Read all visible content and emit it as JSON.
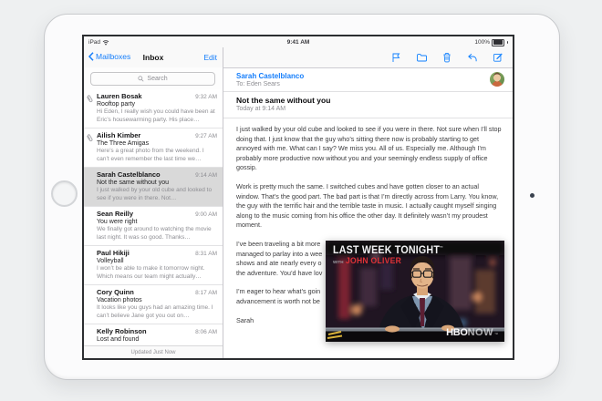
{
  "status_bar": {
    "carrier": "iPad",
    "time": "9:41 AM",
    "battery": "100%"
  },
  "mail_list": {
    "back_label": "Mailboxes",
    "title": "Inbox",
    "edit_label": "Edit",
    "search_placeholder": "Search",
    "footer": "Updated Just Now",
    "emails": [
      {
        "sender": "Lauren Bosak",
        "time": "9:32 AM",
        "subject": "Rooftop party",
        "preview": "Hi Eden, I really wish you could have been at Eric’s housewarming party. His place…",
        "has_attachment": true,
        "selected": false
      },
      {
        "sender": "Ailish Kimber",
        "time": "9:27 AM",
        "subject": "The Three Amigas",
        "preview": "Here’s a great photo from the weekend. I can’t even remember the last time we…",
        "has_attachment": true,
        "selected": false
      },
      {
        "sender": "Sarah Castelblanco",
        "time": "9:14 AM",
        "subject": "Not the same without you",
        "preview": "I just walked by your old cube and looked to see if you were in there. Not…",
        "has_attachment": false,
        "selected": true
      },
      {
        "sender": "Sean Reilly",
        "time": "9:00 AM",
        "subject": "You were right",
        "preview": "We finally got around to watching the movie last night. It was so good. Thanks…",
        "has_attachment": false,
        "selected": false
      },
      {
        "sender": "Paul Hikiji",
        "time": "8:31 AM",
        "subject": "Volleyball",
        "preview": "I won’t be able to make it tomorrow night. Which means our team might actually…",
        "has_attachment": false,
        "selected": false
      },
      {
        "sender": "Cory Quinn",
        "time": "8:17 AM",
        "subject": "Vacation photos",
        "preview": "It looks like you guys had an amazing time. I can’t believe Jane got you out on…",
        "has_attachment": false,
        "selected": false
      },
      {
        "sender": "Kelly Robinson",
        "time": "8:06 AM",
        "subject": "Lost and found",
        "preview": "",
        "has_attachment": false,
        "selected": false
      }
    ]
  },
  "toolbar": {
    "icons": [
      "flag-icon",
      "folder-icon",
      "trash-icon",
      "reply-icon",
      "compose-icon"
    ]
  },
  "message": {
    "sender": "Sarah Castelblanco",
    "recipient": "To: Eden Sears",
    "subject": "Not the same without you",
    "date": "Today at 9:14 AM",
    "paragraph1": "I just walked by your old cube and looked to see if you were in there. Not sure when I’ll stop doing that. I just know that the guy who’s sitting there now is probably starting to get annoyed with me. What can I say? We miss you. All of us. Especially me. Although I’m probably more productive now without you and your seemingly endless supply of office gossip.",
    "paragraph2": "Work is pretty much the same. I switched cubes and have gotten closer to an actual window. That’s the good part. The bad part is that I’m directly across from Larry. You know, the guy with the terrific hair and the terrible taste in music. I actually caught myself singing along to the music coming from his office the other day. It definitely wasn’t my proudest moment.",
    "paragraph3_lines": [
      "I’ve been traveling a bit more",
      "managed to parlay into a wee",
      "shows and ate nearly every o",
      "the adventure. You’d have lov"
    ],
    "paragraph4_lines": [
      "I’m eager to hear what’s goin",
      "advancement is worth not be"
    ],
    "signature": "Sarah"
  },
  "video": {
    "show_title": "LAST WEEK TONIGHT",
    "trademark": "™",
    "with_label": "WITH",
    "host": "JOHN OLIVER",
    "network": "HBO",
    "service": "NOW",
    "accent_red": "#e03237"
  },
  "colors": {
    "ios_blue": "#157efb",
    "selected_row": "#d9d9d9",
    "muted_text": "#8e8e93",
    "hairline": "#c8c7cc"
  }
}
